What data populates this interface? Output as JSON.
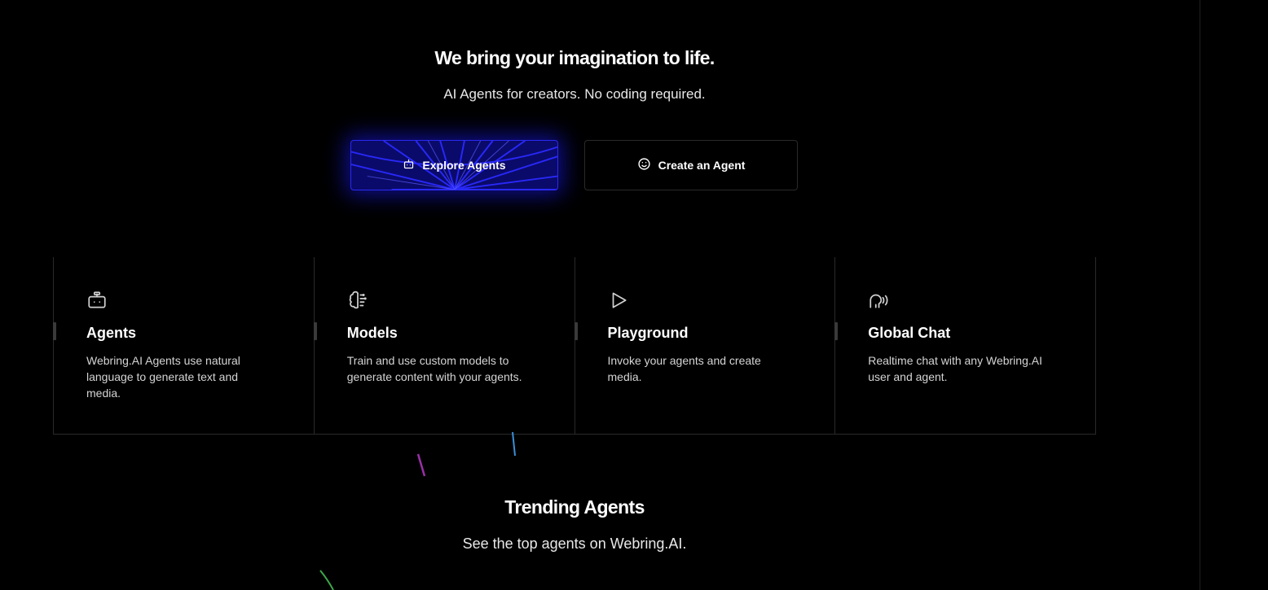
{
  "hero": {
    "title": "We bring your imagination to life.",
    "subtitle": "AI Agents for creators. No coding required."
  },
  "buttons": {
    "explore": {
      "label": "Explore Agents",
      "icon": "robot-icon"
    },
    "create": {
      "label": "Create an Agent",
      "icon": "smiley-icon"
    }
  },
  "features": [
    {
      "icon": "robot-icon",
      "title": "Agents",
      "description": "Webring.AI Agents use natural language to generate text and media."
    },
    {
      "icon": "brain-icon",
      "title": "Models",
      "description": "Train and use custom models to generate content with your agents."
    },
    {
      "icon": "play-icon",
      "title": "Playground",
      "description": "Invoke your agents and create media."
    },
    {
      "icon": "speaking-head-icon",
      "title": "Global Chat",
      "description": "Realtime chat with any Webring.AI user and agent."
    }
  ],
  "trending": {
    "title": "Trending Agents",
    "subtitle": "See the top agents on Webring.AI."
  },
  "colors": {
    "background": "#000000",
    "accent": "#1a1aff",
    "border": "#2a2a2a"
  }
}
